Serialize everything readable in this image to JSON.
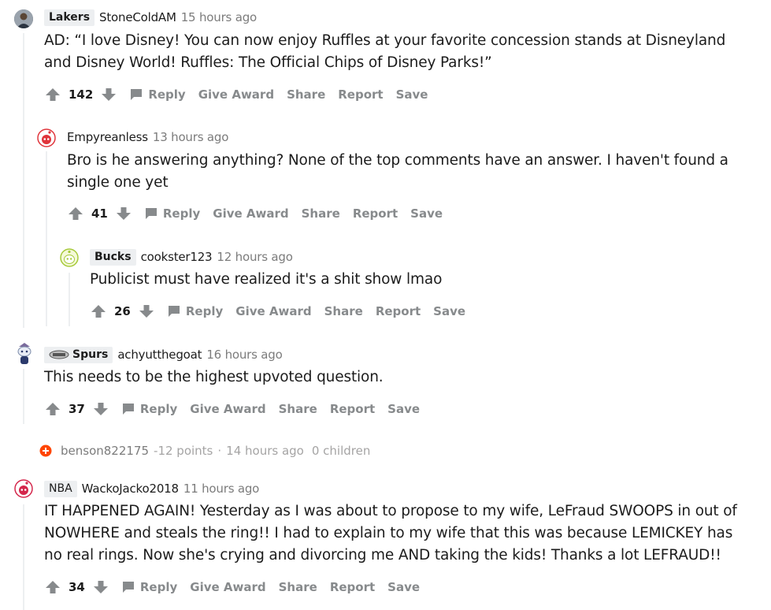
{
  "comments": [
    {
      "flair": "Lakers",
      "author": "StoneColdAM",
      "time": "15 hours ago",
      "body_lines": [
        "AD: “I love Disney! You can now enjoy Ruffles at your favorite concession stands at Disneyland",
        "and Disney World! Ruffles: The Official Chips of Disney Parks!”"
      ],
      "score": "142",
      "actions": {
        "reply": "Reply",
        "award": "Give Award",
        "share": "Share",
        "report": "Report",
        "save": "Save"
      }
    },
    {
      "author": "Empyreanless",
      "time": "13 hours ago",
      "body_lines": [
        "Bro is he answering anything? None of the top comments have an answer. I haven't found a",
        "single one yet"
      ],
      "score": "41",
      "actions": {
        "reply": "Reply",
        "award": "Give Award",
        "share": "Share",
        "report": "Report",
        "save": "Save"
      }
    },
    {
      "flair": "Bucks",
      "author": "cookster123",
      "time": "12 hours ago",
      "body_lines": [
        "Publicist must have realized it's a shit show lmao"
      ],
      "score": "26",
      "actions": {
        "reply": "Reply",
        "award": "Give Award",
        "share": "Share",
        "report": "Report",
        "save": "Save"
      }
    },
    {
      "flair": "Spurs",
      "author": "achyutthegoat",
      "time": "16 hours ago",
      "body_lines": [
        "This needs to be the highest upvoted question."
      ],
      "score": "37",
      "actions": {
        "reply": "Reply",
        "award": "Give Award",
        "share": "Share",
        "report": "Report",
        "save": "Save"
      }
    },
    {
      "flair": "NBA",
      "author": "WackoJacko2018",
      "time": "11 hours ago",
      "body_lines": [
        "IT HAPPENED AGAIN! Yesterday as I was about to propose to my wife, LeFraud SWOOPS in out of",
        "NOWHERE and steals the ring!! I had to explain to my wife that this was because LEMICKEY has",
        "no real rings. Now she's crying and divorcing me AND taking the kids! Thanks a lot LEFRAUD!!"
      ],
      "score": "34",
      "actions": {
        "reply": "Reply",
        "award": "Give Award",
        "share": "Share",
        "report": "Report",
        "save": "Save"
      }
    }
  ],
  "collapsed": {
    "author": "benson822175",
    "points": "-12 points",
    "sep": "·",
    "time": "14 hours ago",
    "children": "0 children"
  },
  "colors": {
    "accent_orange": "#ff4500",
    "upvote_gray": "#878a8c",
    "thread_line": "#edeff1"
  },
  "icons": [
    "upvote-arrow-icon",
    "downvote-arrow-icon",
    "comment-bubble-icon",
    "avatar-icon",
    "spurs-flair-icon",
    "collapse-plus-icon"
  ]
}
